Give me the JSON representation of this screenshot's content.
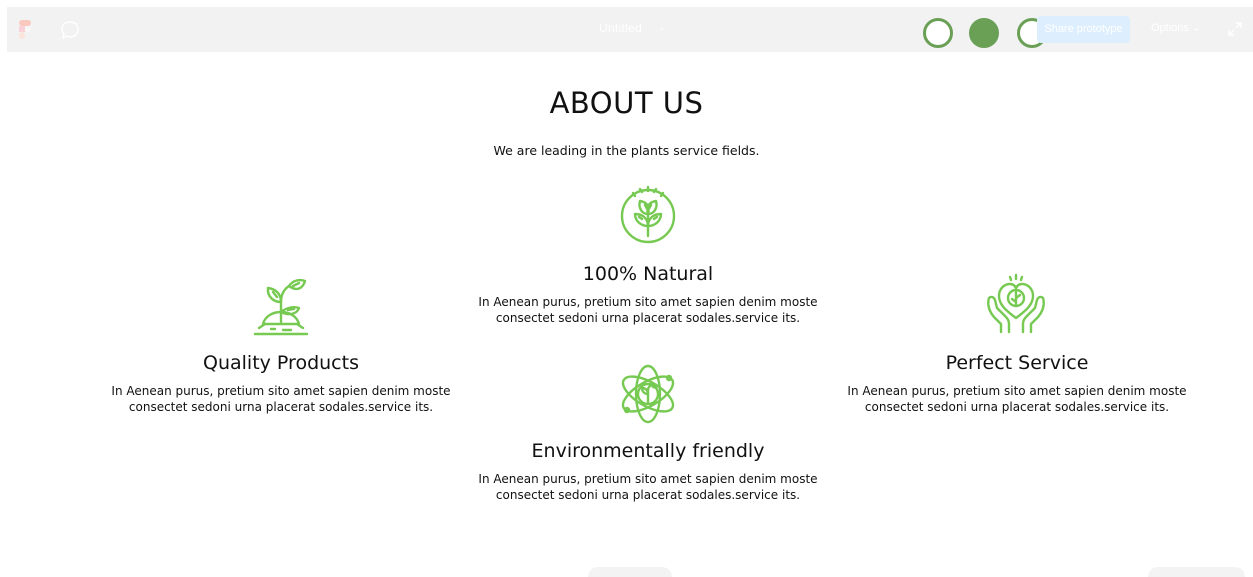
{
  "toolbar": {
    "file_title": "Untitled",
    "title_chevron": "⌄",
    "primary_button": "Share prototype",
    "options_label": "Options",
    "options_chevron": "⌄",
    "logo_icon": "figma-logo-icon",
    "comment_icon": "comment-icon",
    "expand_icon": "expand-icon",
    "circle_color": "#6a9f56"
  },
  "about": {
    "heading": "ABOUT US",
    "subheading": "We are leading in the plants service fields."
  },
  "features": {
    "natural": {
      "icon": "leaves-circle-icon",
      "title": "100% Natural",
      "desc_line1": "In Aenean purus, pretium sito amet sapien denim moste",
      "desc_line2": "consectet sedoni urna placerat sodales.service its."
    },
    "quality": {
      "icon": "sprout-icon",
      "title": "Quality Products",
      "desc_line1": "In Aenean purus, pretium sito amet sapien denim moste",
      "desc_line2": "consectet sedoni urna placerat sodales.service its."
    },
    "service": {
      "icon": "hands-heart-leaf-icon",
      "title": "Perfect Service",
      "desc_line1": "In Aenean purus, pretium sito amet sapien denim moste",
      "desc_line2": "consectet sedoni urna placerat sodales.service its."
    },
    "environment": {
      "icon": "eco-atom-icon",
      "title": "Environmentally friendly",
      "desc_line1": "In Aenean purus, pretium sito amet sapien denim moste",
      "desc_line2": "consectet sedoni urna placerat sodales.service its."
    }
  },
  "colors": {
    "accent_green": "#76c951",
    "toolbar_bg": "#f2f2f2"
  }
}
